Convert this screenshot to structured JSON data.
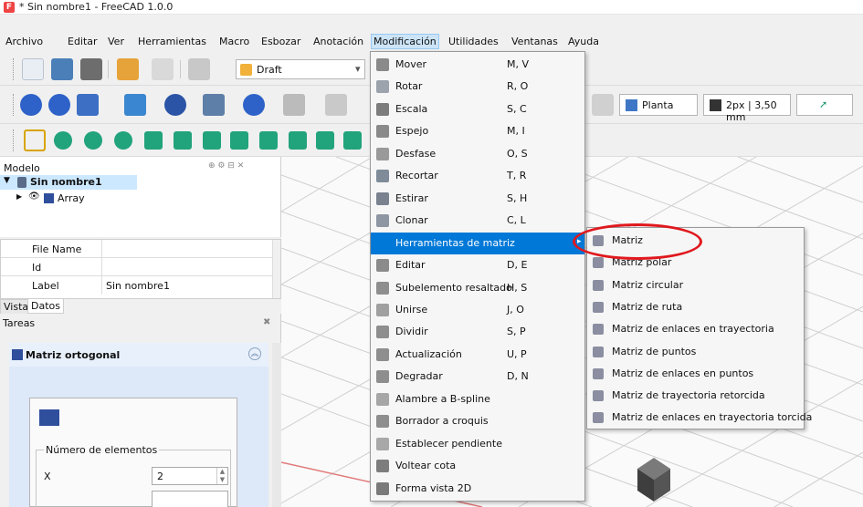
{
  "window": {
    "title": "* Sin nombre1 - FreeCAD 1.0.0",
    "app_icon": "freecad-icon"
  },
  "menubar": [
    "Archivo",
    "Editar",
    "Ver",
    "Herramientas",
    "Macro",
    "Esbozar",
    "Anotación",
    "Modificación",
    "Utilidades",
    "Ventanas",
    "Ayuda"
  ],
  "menubar_active_index": 7,
  "toolbar": {
    "workbench": "Draft",
    "view_preset": "Planta",
    "line_style": "2px | 3,50 mm"
  },
  "model_tree": {
    "header": "Modelo",
    "document": "Sin nombre1",
    "child": "Array"
  },
  "properties": {
    "rows": [
      {
        "name": "File Name",
        "value": ""
      },
      {
        "name": "Id",
        "value": ""
      },
      {
        "name": "Label",
        "value": "Sin nombre1"
      }
    ],
    "tabs": [
      "Vista",
      "Datos"
    ],
    "active_tab": "Datos"
  },
  "tasks": {
    "header": "Tareas",
    "panel_title": "Matriz ortogonal",
    "group_label": "Número de elementos",
    "x_label": "X",
    "x_value": "2"
  },
  "modification_menu": [
    {
      "label": "Mover",
      "shortcut": "M, V",
      "icon": "move-icon"
    },
    {
      "label": "Rotar",
      "shortcut": "R, O",
      "icon": "rotate-icon"
    },
    {
      "label": "Escala",
      "shortcut": "S, C",
      "icon": "scale-icon"
    },
    {
      "label": "Espejo",
      "shortcut": "M, I",
      "icon": "mirror-icon"
    },
    {
      "label": "Desfase",
      "shortcut": "O, S",
      "icon": "offset-icon"
    },
    {
      "label": "Recortar",
      "shortcut": "T, R",
      "icon": "trim-icon"
    },
    {
      "label": "Estirar",
      "shortcut": "S, H",
      "icon": "stretch-icon"
    },
    {
      "label": "Clonar",
      "shortcut": "C, L",
      "icon": "clone-icon"
    },
    {
      "label": "Herramientas de matriz",
      "shortcut": "",
      "icon": "",
      "submenu": true
    },
    {
      "label": "Editar",
      "shortcut": "D, E",
      "icon": "edit-icon"
    },
    {
      "label": "Subelemento resaltado",
      "shortcut": "H, S",
      "icon": "subelement-icon"
    },
    {
      "label": "Unirse",
      "shortcut": "J, O",
      "icon": "join-icon"
    },
    {
      "label": "Dividir",
      "shortcut": "S, P",
      "icon": "split-icon"
    },
    {
      "label": "Actualización",
      "shortcut": "U, P",
      "icon": "upgrade-icon"
    },
    {
      "label": "Degradar",
      "shortcut": "D, N",
      "icon": "downgrade-icon"
    },
    {
      "label": "Alambre a B-spline",
      "shortcut": "",
      "icon": "wire-bspline-icon"
    },
    {
      "label": "Borrador a croquis",
      "shortcut": "",
      "icon": "draft-to-sketch-icon"
    },
    {
      "label": "Establecer pendiente",
      "shortcut": "",
      "icon": "slope-icon"
    },
    {
      "label": "Voltear cota",
      "shortcut": "",
      "icon": "flip-dimension-icon"
    },
    {
      "label": "Forma vista 2D",
      "shortcut": "",
      "icon": "shape-2d-view-icon"
    }
  ],
  "array_submenu": [
    "Matriz",
    "Matriz polar",
    "Matriz circular",
    "Matriz de ruta",
    "Matriz de enlaces en trayectoria",
    "Matriz de puntos",
    "Matriz de enlaces en puntos",
    "Matriz de trayectoria retorcida",
    "Matriz de enlaces en trayectoria torcida"
  ],
  "colors": {
    "highlight": "#0078d7",
    "annotation_circle": "#e0181d"
  }
}
